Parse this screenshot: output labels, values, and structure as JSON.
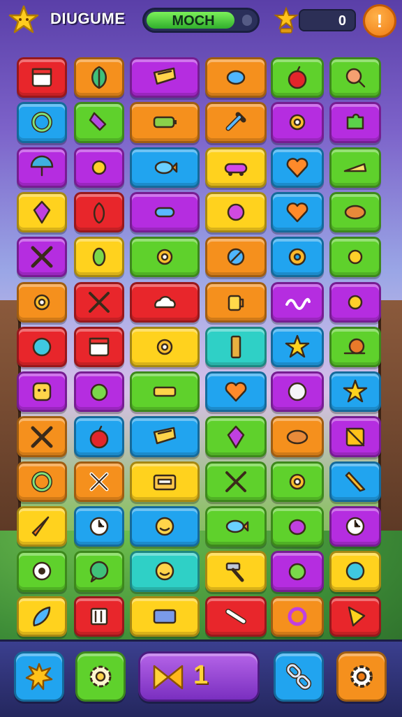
{
  "hud": {
    "title": "DIUGUME",
    "meter_label": "MOCH",
    "meter_progress": 0.78,
    "score": "0",
    "alert_label": "!",
    "logo_icon": "star-logo-icon",
    "score_icon": "star-trophy-icon"
  },
  "colors": {
    "red": "#e8262b",
    "orange": "#f5901d",
    "yellow": "#ffd21e",
    "green": "#5fd12c",
    "blue": "#21a4ef",
    "purple": "#b52de0",
    "teal": "#2fd0c6"
  },
  "board": {
    "rows": [
      [
        {
          "color": "red",
          "icon": "note-card-icon"
        },
        {
          "color": "orange",
          "icon": "leaf-icon"
        },
        {
          "color": "purple",
          "icon": "ticket-icon"
        },
        {
          "color": "orange",
          "icon": "candy-icon"
        },
        {
          "color": "green",
          "icon": "apple-icon"
        },
        {
          "color": "green",
          "icon": "magnifier-icon"
        }
      ],
      [
        {
          "color": "blue",
          "icon": "ring-icon"
        },
        {
          "color": "green",
          "icon": "potion-icon"
        },
        {
          "color": "orange",
          "icon": "battery-icon"
        },
        {
          "color": "orange",
          "icon": "wrench-icon"
        },
        {
          "color": "purple",
          "icon": "gear-icon"
        },
        {
          "color": "purple",
          "icon": "puzzle-icon"
        }
      ],
      [
        {
          "color": "purple",
          "icon": "umbrella-icon"
        },
        {
          "color": "purple",
          "icon": "sun-icon"
        },
        {
          "color": "blue",
          "icon": "fish-icon"
        },
        {
          "color": "yellow",
          "icon": "car-icon"
        },
        {
          "color": "blue",
          "icon": "heart-icon"
        },
        {
          "color": "green",
          "icon": "cheese-icon"
        }
      ],
      [
        {
          "color": "yellow",
          "icon": "gem-icon"
        },
        {
          "color": "red",
          "icon": "pepper-icon"
        },
        {
          "color": "purple",
          "icon": "bolt-icon"
        },
        {
          "color": "yellow",
          "icon": "blob-icon"
        },
        {
          "color": "blue",
          "icon": "heart-icon"
        },
        {
          "color": "green",
          "icon": "cookie-icon"
        }
      ],
      [
        {
          "color": "purple",
          "icon": "scissors-icon"
        },
        {
          "color": "yellow",
          "icon": "seed-icon"
        },
        {
          "color": "green",
          "icon": "gear-icon"
        },
        {
          "color": "orange",
          "icon": "pen-icon"
        },
        {
          "color": "blue",
          "icon": "pretzel-icon"
        },
        {
          "color": "green",
          "icon": "sun-icon"
        }
      ],
      [
        {
          "color": "orange",
          "icon": "gear-icon"
        },
        {
          "color": "red",
          "icon": "tools-icon"
        },
        {
          "color": "red",
          "icon": "cloud-icon"
        },
        {
          "color": "orange",
          "icon": "mug-icon"
        },
        {
          "color": "purple",
          "icon": "wave-icon"
        },
        {
          "color": "purple",
          "icon": "sun-icon"
        }
      ],
      [
        {
          "color": "red",
          "icon": "ball-icon"
        },
        {
          "color": "red",
          "icon": "note-card-icon"
        },
        {
          "color": "yellow",
          "icon": "gear-icon"
        },
        {
          "color": "teal",
          "icon": "broom-icon"
        },
        {
          "color": "blue",
          "icon": "star-icon"
        },
        {
          "color": "green",
          "icon": "snail-icon"
        }
      ],
      [
        {
          "color": "purple",
          "icon": "face-icon"
        },
        {
          "color": "purple",
          "icon": "lime-icon"
        },
        {
          "color": "green",
          "icon": "ruler-icon"
        },
        {
          "color": "blue",
          "icon": "heart-icon"
        },
        {
          "color": "purple",
          "icon": "pearl-icon"
        },
        {
          "color": "blue",
          "icon": "star-icon"
        }
      ],
      [
        {
          "color": "orange",
          "icon": "scissors-icon"
        },
        {
          "color": "blue",
          "icon": "apple-icon"
        },
        {
          "color": "blue",
          "icon": "ticket-icon"
        },
        {
          "color": "green",
          "icon": "gem-icon"
        },
        {
          "color": "orange",
          "icon": "cookie-icon"
        },
        {
          "color": "purple",
          "icon": "box-icon"
        }
      ],
      [
        {
          "color": "orange",
          "icon": "ring-icon"
        },
        {
          "color": "orange",
          "icon": "cross-icon"
        },
        {
          "color": "yellow",
          "icon": "cassette-icon"
        },
        {
          "color": "green",
          "icon": "tools-icon"
        },
        {
          "color": "green",
          "icon": "gear-icon"
        },
        {
          "color": "blue",
          "icon": "pencil-icon"
        }
      ],
      [
        {
          "color": "yellow",
          "icon": "carrot-icon"
        },
        {
          "color": "blue",
          "icon": "clock-icon"
        },
        {
          "color": "blue",
          "icon": "smiley-icon"
        },
        {
          "color": "green",
          "icon": "fish-icon"
        },
        {
          "color": "green",
          "icon": "plum-icon"
        },
        {
          "color": "purple",
          "icon": "clock-icon"
        }
      ],
      [
        {
          "color": "green",
          "icon": "eye-icon"
        },
        {
          "color": "green",
          "icon": "bubble-icon"
        },
        {
          "color": "teal",
          "icon": "smiley-icon"
        },
        {
          "color": "yellow",
          "icon": "hammer-icon"
        },
        {
          "color": "purple",
          "icon": "lime-icon"
        },
        {
          "color": "yellow",
          "icon": "ball-icon"
        }
      ],
      [
        {
          "color": "yellow",
          "icon": "feather-icon"
        },
        {
          "color": "red",
          "icon": "bracket-icon"
        },
        {
          "color": "yellow",
          "icon": "book-icon"
        },
        {
          "color": "red",
          "icon": "bone-icon"
        },
        {
          "color": "orange",
          "icon": "swirl-icon"
        },
        {
          "color": "red",
          "icon": "flag-icon"
        }
      ]
    ]
  },
  "bottom": {
    "level_number": "1",
    "buttons": [
      {
        "color": "blue",
        "icon": "sun-burst-icon"
      },
      {
        "color": "green",
        "icon": "gear-icon"
      },
      {
        "color": "blue",
        "icon": "chain-link-icon"
      },
      {
        "color": "orange",
        "icon": "settings-gear-icon"
      }
    ]
  }
}
